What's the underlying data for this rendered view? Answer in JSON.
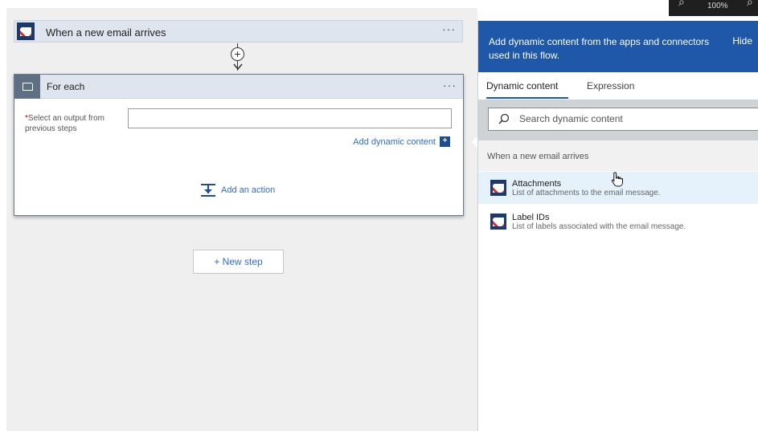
{
  "zoom": {
    "value": "100%"
  },
  "trigger": {
    "title": "When a new email arrives",
    "menu": "···"
  },
  "foreach": {
    "title": "For each",
    "menu": "···",
    "field_required_mark": "*",
    "field_label": "Select an output from previous steps",
    "field_value": "",
    "add_dynamic_content": "Add dynamic content",
    "add_dynamic_plus": "+",
    "add_action": "Add an action"
  },
  "new_step": {
    "label": "+ New step"
  },
  "panel": {
    "header_message": "Add dynamic content from the apps and connectors used in this flow.",
    "hide_label": "Hide",
    "tabs": [
      {
        "label": "Dynamic content",
        "active": true
      },
      {
        "label": "Expression",
        "active": false
      }
    ],
    "search": {
      "placeholder": "Search dynamic content",
      "value": ""
    },
    "section_title": "When a new email arrives",
    "items": [
      {
        "name": "Attachments",
        "description": "List of attachments to the email message.",
        "icon": "gmail-icon"
      },
      {
        "name": "Label IDs",
        "description": "List of labels associated with the email message.",
        "icon": "gmail-icon"
      }
    ]
  },
  "colors": {
    "panel_header": "#1f58a8",
    "link": "#2f6ccf",
    "gmail_badge": "#1a3a6e",
    "gmail_red": "#d93025",
    "card_header": "#dfe5ee"
  }
}
